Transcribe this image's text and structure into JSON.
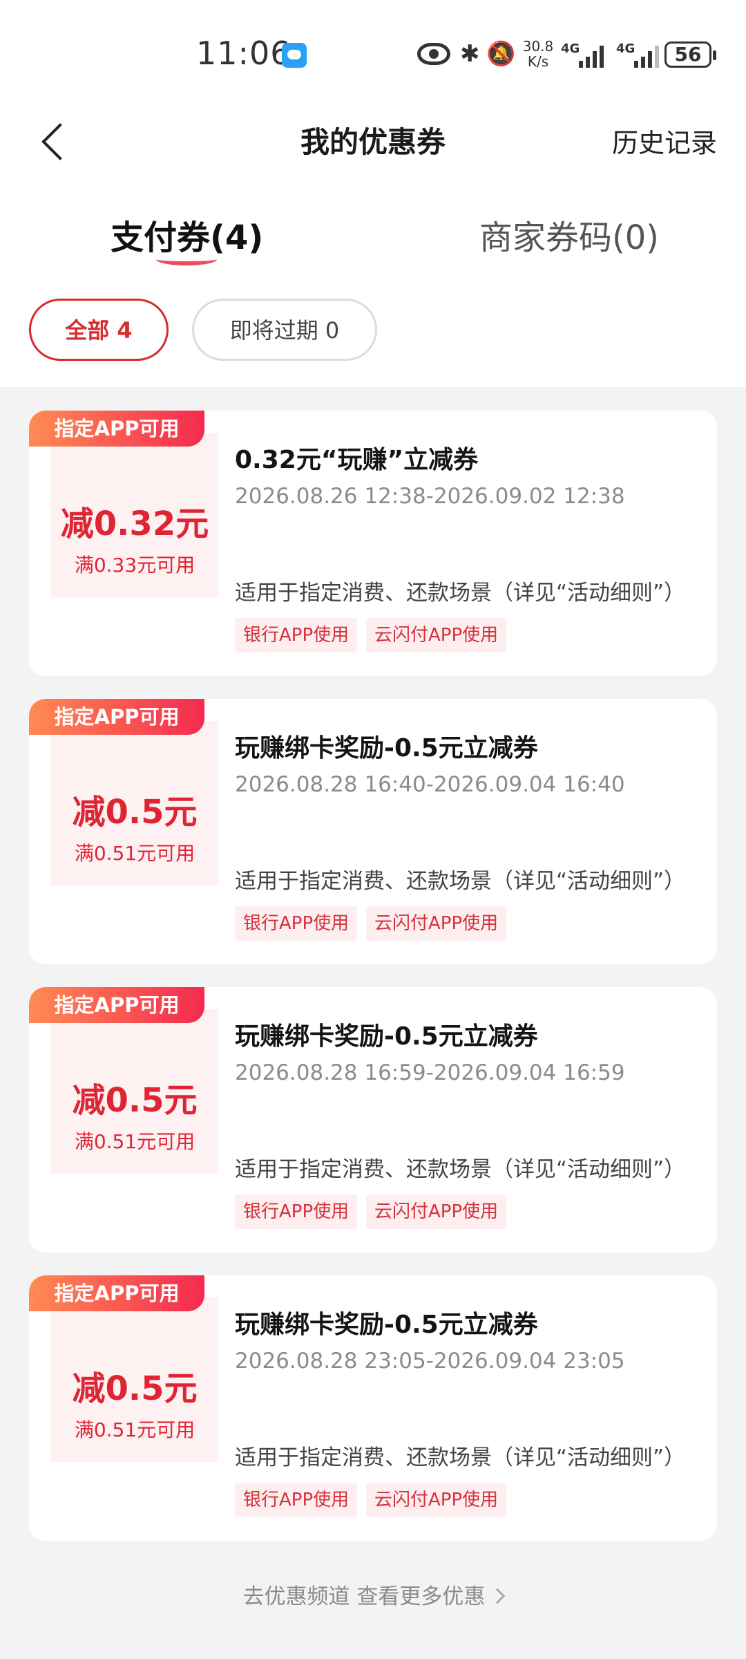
{
  "status_bar": {
    "time": "11:06",
    "net_speed_value": "30.8",
    "net_speed_unit": "K/s",
    "sig1_label": "4G",
    "sig2_label": "4G",
    "battery": "56"
  },
  "nav": {
    "title": "我的优惠券",
    "history": "历史记录"
  },
  "tabs": [
    {
      "label": "支付券(4)",
      "active": true
    },
    {
      "label": "商家券码(0)",
      "active": false
    }
  ],
  "filters": [
    {
      "label": "全部 4",
      "selected": true
    },
    {
      "label": "即将过期 0",
      "selected": false
    }
  ],
  "coupons": [
    {
      "tag": "指定APP可用",
      "amount": "减0.32元",
      "min": "满0.33元可用",
      "title": "0.32元“玩赚”立减券",
      "time": "2026.08.26 12:38-2026.09.02 12:38",
      "desc": "适用于指定消费、还款场景（详见“活动细则”）",
      "badges": [
        "银行APP使用",
        "云闪付APP使用"
      ]
    },
    {
      "tag": "指定APP可用",
      "amount": "减0.5元",
      "min": "满0.51元可用",
      "title": "玩赚绑卡奖励-0.5元立减券",
      "time": "2026.08.28 16:40-2026.09.04 16:40",
      "desc": "适用于指定消费、还款场景（详见“活动细则”）",
      "badges": [
        "银行APP使用",
        "云闪付APP使用"
      ]
    },
    {
      "tag": "指定APP可用",
      "amount": "减0.5元",
      "min": "满0.51元可用",
      "title": "玩赚绑卡奖励-0.5元立减券",
      "time": "2026.08.28 16:59-2026.09.04 16:59",
      "desc": "适用于指定消费、还款场景（详见“活动细则”）",
      "badges": [
        "银行APP使用",
        "云闪付APP使用"
      ]
    },
    {
      "tag": "指定APP可用",
      "amount": "减0.5元",
      "min": "满0.51元可用",
      "title": "玩赚绑卡奖励-0.5元立减券",
      "time": "2026.08.28 23:05-2026.09.04 23:05",
      "desc": "适用于指定消费、还款场景（详见“活动细则”）",
      "badges": [
        "银行APP使用",
        "云闪付APP使用"
      ]
    }
  ],
  "footer": {
    "more": "去优惠频道 查看更多优惠"
  },
  "colors": {
    "accent": "#e02433",
    "tag_gradient_start": "#ff8a55",
    "tag_gradient_end": "#f42a4f"
  }
}
